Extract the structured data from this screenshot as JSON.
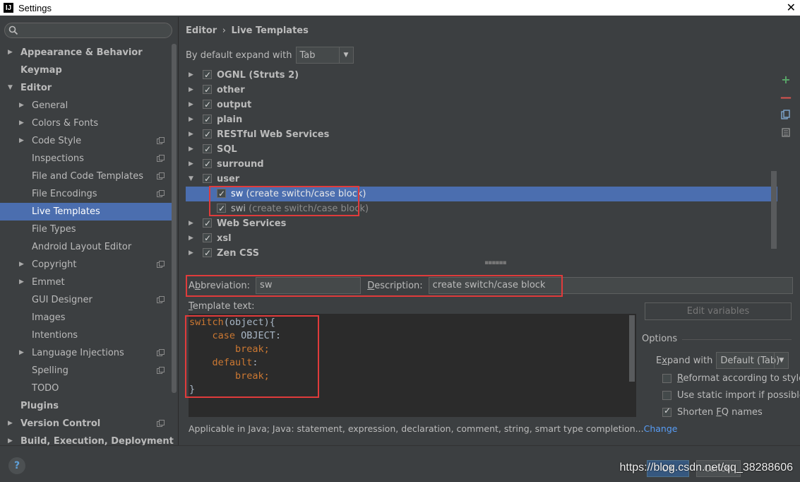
{
  "window": {
    "title": "Settings",
    "logo": "IJ"
  },
  "search": {
    "placeholder": ""
  },
  "sidebar": {
    "items": [
      {
        "label": "Appearance & Behavior",
        "level": 0,
        "bold": true,
        "arrow": "right"
      },
      {
        "label": "Keymap",
        "level": 0,
        "bold": true,
        "arrow": ""
      },
      {
        "label": "Editor",
        "level": 0,
        "bold": true,
        "arrow": "down"
      },
      {
        "label": "General",
        "level": 1,
        "arrow": "right"
      },
      {
        "label": "Colors & Fonts",
        "level": 1,
        "arrow": "right"
      },
      {
        "label": "Code Style",
        "level": 1,
        "arrow": "right",
        "project": true
      },
      {
        "label": "Inspections",
        "level": 1,
        "arrow": "",
        "project": true
      },
      {
        "label": "File and Code Templates",
        "level": 1,
        "arrow": "",
        "project": true
      },
      {
        "label": "File Encodings",
        "level": 1,
        "arrow": "",
        "project": true
      },
      {
        "label": "Live Templates",
        "level": 1,
        "arrow": "",
        "selected": true
      },
      {
        "label": "File Types",
        "level": 1,
        "arrow": ""
      },
      {
        "label": "Android Layout Editor",
        "level": 1,
        "arrow": ""
      },
      {
        "label": "Copyright",
        "level": 1,
        "arrow": "right",
        "project": true
      },
      {
        "label": "Emmet",
        "level": 1,
        "arrow": "right"
      },
      {
        "label": "GUI Designer",
        "level": 1,
        "arrow": "",
        "project": true
      },
      {
        "label": "Images",
        "level": 1,
        "arrow": ""
      },
      {
        "label": "Intentions",
        "level": 1,
        "arrow": ""
      },
      {
        "label": "Language Injections",
        "level": 1,
        "arrow": "right",
        "project": true
      },
      {
        "label": "Spelling",
        "level": 1,
        "arrow": "",
        "project": true
      },
      {
        "label": "TODO",
        "level": 1,
        "arrow": ""
      },
      {
        "label": "Plugins",
        "level": 0,
        "bold": true,
        "arrow": ""
      },
      {
        "label": "Version Control",
        "level": 0,
        "bold": true,
        "arrow": "right",
        "project": true
      },
      {
        "label": "Build, Execution, Deployment",
        "level": 0,
        "bold": true,
        "arrow": "right"
      }
    ]
  },
  "main": {
    "breadcrumb_parent": "Editor",
    "breadcrumb_sep": "›",
    "breadcrumb_current": "Live Templates",
    "expand_label": "By default expand with",
    "expand_value": "Tab",
    "groups": [
      {
        "name": "OGNL (Struts 2)",
        "checked": true,
        "expanded": false
      },
      {
        "name": "other",
        "checked": true,
        "expanded": false
      },
      {
        "name": "output",
        "checked": true,
        "expanded": false
      },
      {
        "name": "plain",
        "checked": true,
        "expanded": false
      },
      {
        "name": "RESTful Web Services",
        "checked": true,
        "expanded": false
      },
      {
        "name": "SQL",
        "checked": true,
        "expanded": false
      },
      {
        "name": "surround",
        "checked": true,
        "expanded": false
      },
      {
        "name": "user",
        "checked": true,
        "expanded": true,
        "children": [
          {
            "abbr": "sw",
            "desc": "(create switch/case block)",
            "checked": true,
            "selected": true
          },
          {
            "abbr": "swi",
            "desc": "(create switch/case block)",
            "checked": true,
            "selected": false
          }
        ]
      },
      {
        "name": "Web Services",
        "checked": true,
        "expanded": false
      },
      {
        "name": "xsl",
        "checked": true,
        "expanded": false
      },
      {
        "name": "Zen CSS",
        "checked": true,
        "expanded": false
      }
    ],
    "abbreviation_label_pre": "A",
    "abbreviation_label_u": "b",
    "abbreviation_label_post": "breviation:",
    "abbreviation_value": "sw",
    "description_label_u": "D",
    "description_label_post": "escription:",
    "description_value": "create switch/case block",
    "template_text_label_u": "T",
    "template_text_label_post": "emplate text:",
    "code": {
      "l1_kw": "switch",
      "l1_rest": "(object){",
      "l2_kw": "case",
      "l2_rest": " OBJECT:",
      "l3_kw": "break;",
      "l4_kw": "default",
      "l4_rest": ":",
      "l5_kw": "break;",
      "l6": "}"
    },
    "edit_variables": "Edit variables",
    "options_title": "Options",
    "expand_with_pre": "E",
    "expand_with_u": "x",
    "expand_with_post": "pand with",
    "expand_with_value": "Default (Tab)",
    "options": [
      {
        "pre": "",
        "u": "R",
        "post": "eformat according to style",
        "checked": false
      },
      {
        "pre": "Use static import if possible",
        "u": "",
        "post": "",
        "checked": false
      },
      {
        "pre": "Shorten ",
        "u": "F",
        "post": "Q names",
        "checked": true
      }
    ],
    "applicable_text": "Applicable in Java; Java: statement, expression, declaration, comment, string, smart type completion...",
    "change_link": "Change"
  },
  "footer": {
    "help": "?",
    "ok": "OK",
    "cancel": "Cancel",
    "watermark": "https://blog.csdn.net/qq_38288606"
  },
  "colors": {
    "background": "#3c3f41",
    "selection": "#4b6eaf",
    "keyword": "#cc7832",
    "highlight_box": "#e03b3b",
    "add": "#59a869",
    "remove": "#d9534f"
  }
}
